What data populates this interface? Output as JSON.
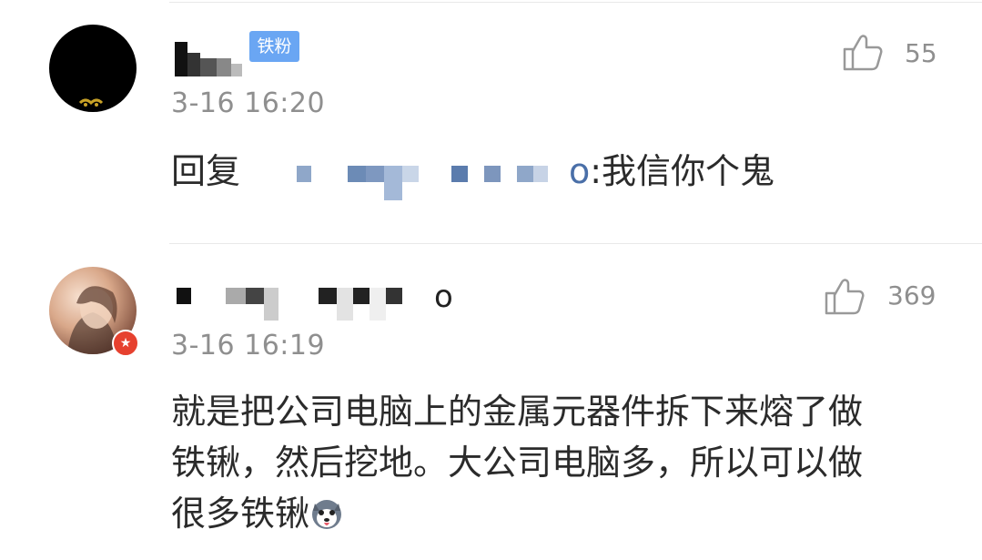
{
  "comments": [
    {
      "badge": "铁粉",
      "time": "3-16 16:20",
      "likes": "55",
      "reply_prefix": "回复",
      "reply_mention_tail": "o",
      "reply_body": ":我信你个鬼",
      "avatar_icon": "user-avatar-black"
    },
    {
      "time": "3-16 16:19",
      "likes": "369",
      "name_tail": "o",
      "body_line1": "就是把公司电脑上的金属元器件拆下来熔了做",
      "body_line2": "铁锹，然后挖地。大公司电脑多，所以可以做",
      "body_line3": "很多铁锹",
      "emoji_icon": "husky-emoji-icon",
      "verified_icon": "star-badge-icon"
    }
  ]
}
